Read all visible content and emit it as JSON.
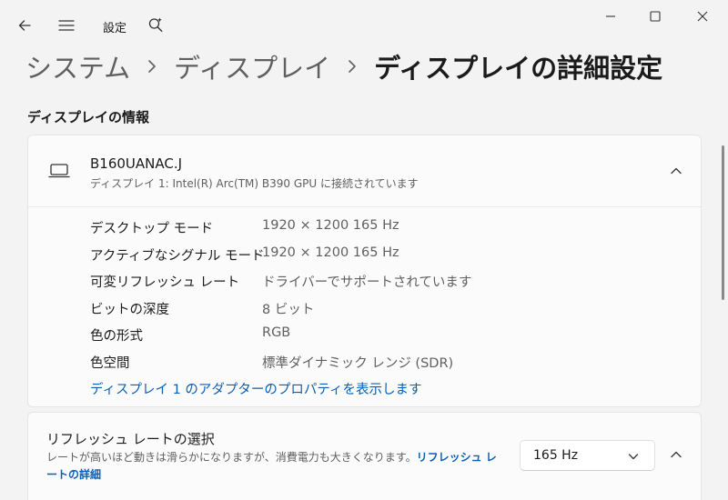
{
  "titlebar": {
    "app_title": "設定"
  },
  "breadcrumb": {
    "items": [
      "システム",
      "ディスプレイ",
      "ディスプレイの詳細設定"
    ]
  },
  "display_info": {
    "section_title": "ディスプレイの情報",
    "monitor_name": "B160UANAC.J",
    "monitor_subtitle": "ディスプレイ 1: Intel(R) Arc(TM) B390 GPU に接続されています",
    "rows": [
      {
        "label": "デスクトップ モード",
        "value": "1920 × 1200 165 Hz"
      },
      {
        "label": "アクティブなシグナル モード",
        "value": "1920 × 1200 165 Hz"
      },
      {
        "label": "可変リフレッシュ レート",
        "value": "ドライバーでサポートされています"
      },
      {
        "label": "ビットの深度",
        "value": "8 ビット"
      },
      {
        "label": "色の形式",
        "value": "RGB"
      },
      {
        "label": "色空間",
        "value": "標準ダイナミック レンジ (SDR)"
      }
    ],
    "adapter_link": "ディスプレイ 1 のアダプターのプロパティを表示します"
  },
  "refresh": {
    "title": "リフレッシュ レートの選択",
    "description": "レートが高いほど動きは滑らかになりますが、消費電力も大きくなります。",
    "link": "リフレッシュ レートの詳細",
    "selected_rate": "165 Hz"
  },
  "icons": {
    "back": "back-arrow-icon",
    "menu": "hamburger-menu-icon",
    "search": "search-sparkle-icon",
    "minimize": "minimize-icon",
    "maximize": "maximize-icon",
    "close": "close-icon",
    "laptop": "laptop-icon",
    "chevron_up": "chevron-up-icon",
    "chevron_down": "chevron-down-icon"
  },
  "colors": {
    "accent_link": "#0a5fb4",
    "background": "#f3f3f3",
    "card": "#fbfbfb"
  }
}
